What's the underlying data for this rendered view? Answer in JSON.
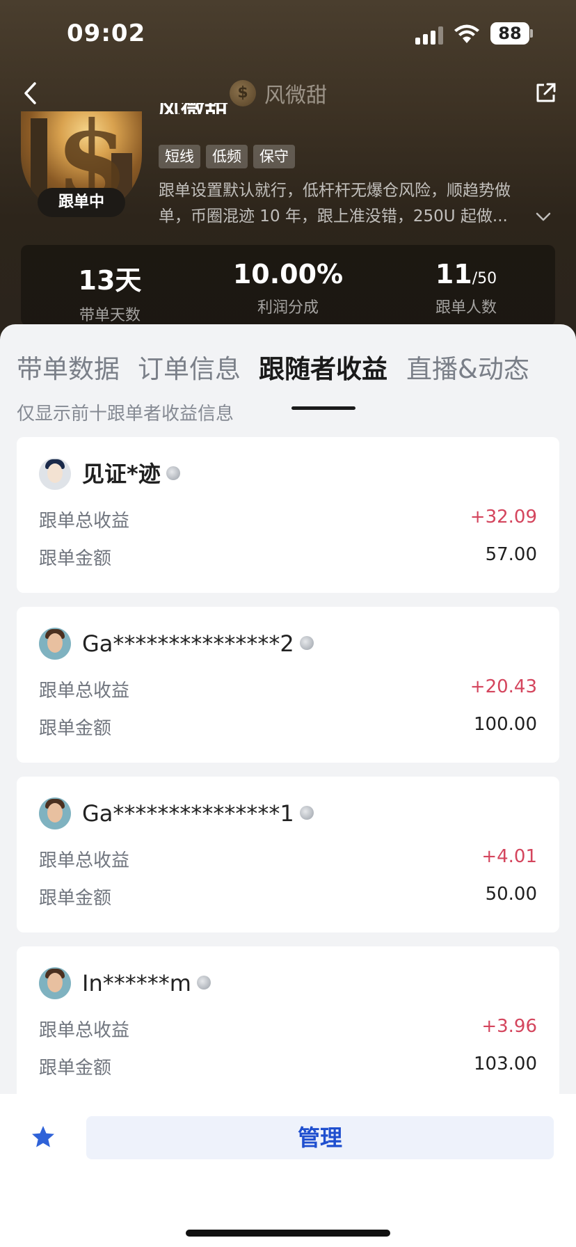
{
  "status_bar": {
    "time": "09:02",
    "battery": "88"
  },
  "nav": {
    "title": "风微甜",
    "logo_glyph": "$"
  },
  "profile": {
    "status_badge": "跟单中",
    "tags": [
      "短线",
      "低频",
      "保守"
    ],
    "description_line1": "跟单设置默认就行，低杆杆无爆仓风险，顺趋势做",
    "description_line2": "单，币圈混迹 10 年，跟上准没错，250U 起做..."
  },
  "stats": [
    {
      "value": "13天",
      "suffix": "",
      "label": "带单天数"
    },
    {
      "value": "10.00%",
      "suffix": "",
      "label": "利润分成"
    },
    {
      "value": "11",
      "suffix": "/50",
      "label": "跟单人数"
    }
  ],
  "tabs": [
    "带单数据",
    "订单信息",
    "跟随者收益",
    "直播&动态"
  ],
  "active_tab": "跟随者收益",
  "hint": "仅显示前十跟单者收益信息",
  "labels": {
    "total_profit": "跟单总收益",
    "amount": "跟单金额"
  },
  "followers": [
    {
      "name": "见证*迹",
      "total_profit": "+32.09",
      "amount": "57.00"
    },
    {
      "name": "Ga***************2",
      "total_profit": "+20.43",
      "amount": "100.00"
    },
    {
      "name": "Ga***************1",
      "total_profit": "+4.01",
      "amount": "50.00"
    },
    {
      "name": "In******m",
      "total_profit": "+3.96",
      "amount": "103.00"
    }
  ],
  "bottom": {
    "manage_label": "管理"
  },
  "colors": {
    "profit": "#d4455d",
    "accent": "#1f4fcf",
    "star": "#2f62d8"
  }
}
